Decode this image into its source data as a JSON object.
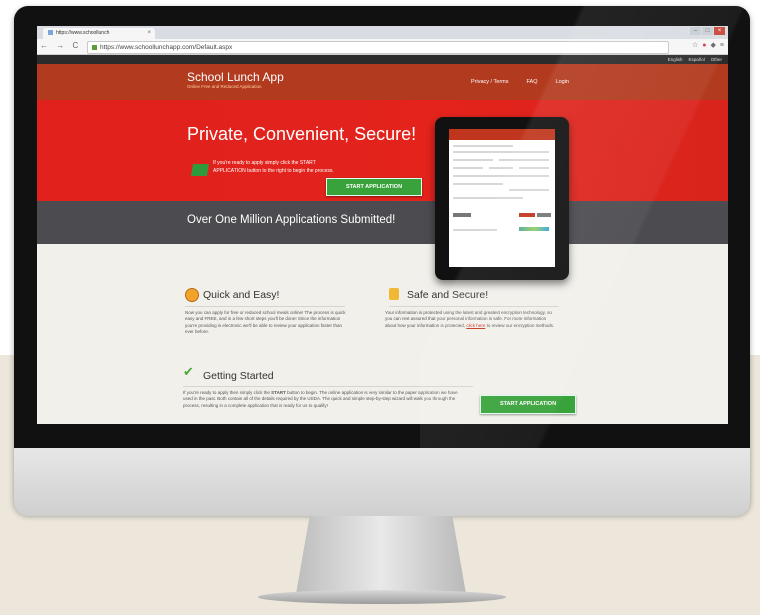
{
  "browser": {
    "tab_title": "https://www.schoollunch",
    "url": "https://www.schoollunchapp.com/Default.aspx",
    "nav_glyphs": "← → C ⌂"
  },
  "site": {
    "languages": [
      "English",
      "Español",
      "Other"
    ],
    "brand": "School Lunch App",
    "brand_sub": "Online Free and Reduced Application",
    "nav": [
      "Privacy / Terms",
      "FAQ",
      "Login"
    ],
    "hero_title": "Private, Convenient, Secure!",
    "hero_text": "If you're ready to apply simply click the START APPLICATION button to the right to begin the process.",
    "start_button": "START APPLICATION",
    "band_text": "Over One Million Applications Submitted!"
  },
  "features": {
    "quick": {
      "title": "Quick and Easy!",
      "text": "Now you can apply for free or reduced school meals online! The process is quick easy and FREE, and in a few short steps you'll be done! Since the information you're providing is electronic we'll be able to review your application faster than ever before."
    },
    "safe": {
      "title": "Safe and Secure!",
      "text_before": "Your information is protected using the latest and greatest encryption technology, so you can rest assured that your personal information is safe. For more information about how your information is protected,",
      "link": "click here",
      "text_after": "to review our encryption methods."
    }
  },
  "getting_started": {
    "title": "Getting Started",
    "text_before": "If you're ready to apply then simply click the",
    "bold": "START",
    "text_after": "button to begin. The online application is very similar to the paper application we have used in the past. Both contain all of the details required by the USDA. The quick and simple step-by-step wizard will walk you through the process, resulting in a complete application that is ready for us to qualify!",
    "button": "START APPLICATION"
  },
  "colors": {
    "header_red": "#b23a1e",
    "hero_red": "#e0211c",
    "band_gray": "#4c4b50",
    "button_green": "#39a23a"
  }
}
